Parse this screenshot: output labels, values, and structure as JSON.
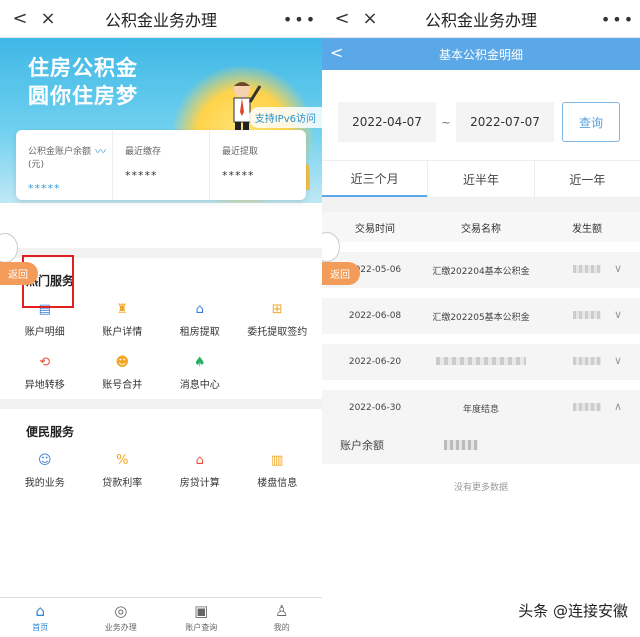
{
  "left": {
    "nav": {
      "title": "公积金业务办理",
      "back": "<",
      "close": "×",
      "more": "•••"
    },
    "banner": {
      "line1": "住房公积金",
      "line2": "圆你住房梦",
      "ipv6": "支持IPv6访问"
    },
    "card": {
      "balance_label": "公积金账户余额(元)",
      "balance_value": "*****",
      "deposit_label": "最近缴存",
      "deposit_value": "*****",
      "withdraw_label": "最近提取",
      "withdraw_value": "*****"
    },
    "hot": {
      "title": "热门服务",
      "items": [
        {
          "label": "账户明细",
          "icon": "clipboard-icon",
          "color": "#3a7fd5"
        },
        {
          "label": "账户详情",
          "icon": "money-bag-icon",
          "color": "#f2a623"
        },
        {
          "label": "租房提取",
          "icon": "house-icon",
          "color": "#3a7fd5"
        },
        {
          "label": "委托提取签约",
          "icon": "cart-icon",
          "color": "#f2a623"
        },
        {
          "label": "异地转移",
          "icon": "transfer-icon",
          "color": "#e5533d"
        },
        {
          "label": "账号合并",
          "icon": "user-merge-icon",
          "color": "#f2a623"
        },
        {
          "label": "消息中心",
          "icon": "bell-icon",
          "color": "#2bae66"
        }
      ]
    },
    "convenience": {
      "title": "便民服务",
      "items": [
        {
          "label": "我的业务",
          "icon": "user-icon",
          "color": "#3a7fd5"
        },
        {
          "label": "贷款利率",
          "icon": "percent-icon",
          "color": "#f2a623"
        },
        {
          "label": "房贷计算",
          "icon": "house-calc-icon",
          "color": "#e5533d"
        },
        {
          "label": "楼盘信息",
          "icon": "building-icon",
          "color": "#f2a623"
        }
      ]
    },
    "return_label": "返回",
    "tabbar": [
      {
        "label": "首页",
        "icon": "home-icon",
        "active": true
      },
      {
        "label": "业务办理",
        "icon": "circle-icon",
        "active": false
      },
      {
        "label": "账户查询",
        "icon": "account-icon",
        "active": false
      },
      {
        "label": "我的",
        "icon": "person-icon",
        "active": false
      }
    ]
  },
  "right": {
    "nav": {
      "title": "公积金业务办理",
      "back": "<",
      "close": "×",
      "more": "•••"
    },
    "subhead": {
      "title": "基本公积金明细",
      "back": "<"
    },
    "date": {
      "start": "2022-04-07",
      "sep": "~",
      "end": "2022-07-07",
      "query": "查询"
    },
    "tabs": [
      "近三个月",
      "近半年",
      "近一年"
    ],
    "table": {
      "headers": [
        "交易时间",
        "交易名称",
        "发生额"
      ],
      "rows": [
        {
          "date": "2022-05-06",
          "name": "汇缴202204基本公积金",
          "chev": "∨"
        },
        {
          "date": "2022-06-08",
          "name": "汇缴202205基本公积金",
          "chev": "∨"
        },
        {
          "date": "2022-06-20",
          "name": "",
          "chev": "∨"
        },
        {
          "date": "2022-06-30",
          "name": "年度结息",
          "chev": "∧"
        }
      ],
      "balance_label": "账户余额"
    },
    "nomore": "没有更多数据",
    "return_label": "返回"
  },
  "watermark": "头条 @连接安徽"
}
